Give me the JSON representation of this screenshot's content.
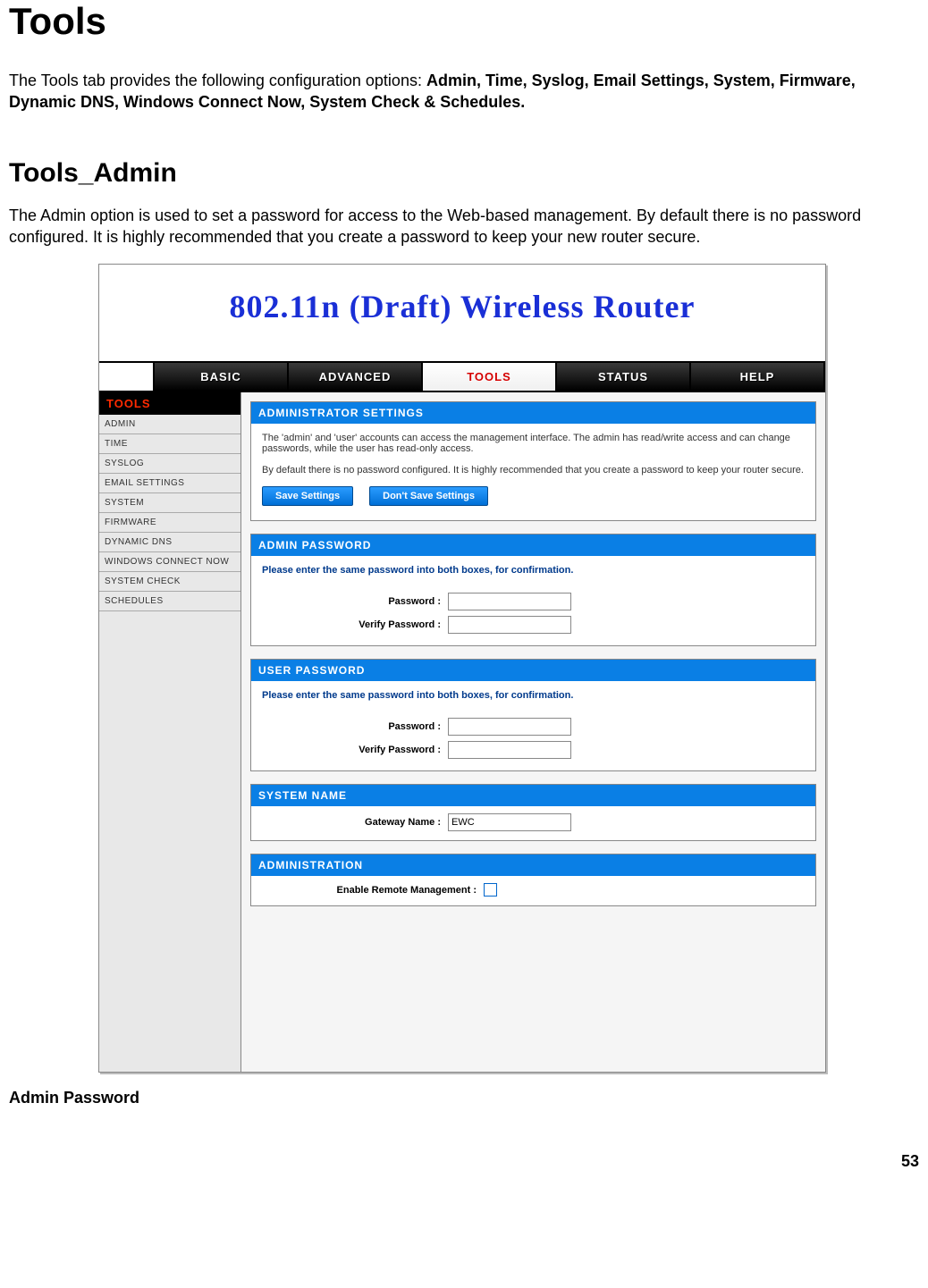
{
  "doc": {
    "title": "Tools",
    "intro_plain": "The Tools tab provides the following configuration options: ",
    "intro_bold": "Admin, Time, Syslog, Email Settings, System, Firmware, Dynamic DNS, Windows Connect Now, System Check & Schedules.",
    "sub_title": "Tools_Admin",
    "sub_intro": "The Admin option is used to set a password for access to the Web-based management. By default there is no password configured. It is highly recommended that you create a password to keep your new router secure.",
    "footer_label": "Admin Password",
    "page_number": "53"
  },
  "router": {
    "banner": "802.11n (Draft) Wireless Router",
    "tabs": [
      "BASIC",
      "ADVANCED",
      "TOOLS",
      "STATUS",
      "HELP"
    ],
    "tabs_active_index": 2,
    "side_title": "TOOLS",
    "side_items": [
      "ADMIN",
      "TIME",
      "SYSLOG",
      "EMAIL SETTINGS",
      "SYSTEM",
      "FIRMWARE",
      "DYNAMIC DNS",
      "WINDOWS CONNECT NOW",
      "SYSTEM CHECK",
      "SCHEDULES"
    ],
    "admin_settings": {
      "title": "ADMINISTRATOR SETTINGS",
      "p1": "The 'admin' and 'user' accounts can access the management interface. The admin has read/write access and can change passwords, while the user has read-only access.",
      "p2": "By default there is no password configured. It is highly recommended that you create a password to keep your router secure.",
      "btn_save": "Save Settings",
      "btn_nosave": "Don't Save Settings"
    },
    "admin_pw": {
      "title": "ADMIN PASSWORD",
      "hint": "Please enter the same password into both boxes, for confirmation.",
      "label_pw": "Password :",
      "label_vpw": "Verify Password :"
    },
    "user_pw": {
      "title": "USER PASSWORD",
      "hint": "Please enter the same password into both boxes, for confirmation.",
      "label_pw": "Password :",
      "label_vpw": "Verify Password :"
    },
    "sys_name": {
      "title": "SYSTEM NAME",
      "label": "Gateway Name :",
      "value": "EWC"
    },
    "administration": {
      "title": "ADMINISTRATION",
      "label": "Enable Remote Management :",
      "checked": false
    }
  }
}
